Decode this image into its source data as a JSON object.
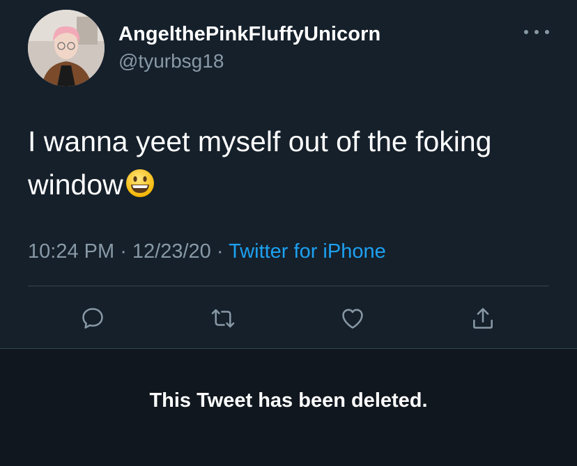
{
  "tweet": {
    "display_name": "AngelthePinkFluffyUnicorn",
    "handle": "@tyurbsg18",
    "text_line1": "I wanna yeet myself out of the foking",
    "text_line2": "window",
    "emoji": "grinning-face-emoji",
    "time": "10:24 PM",
    "separator1": " · ",
    "date": "12/23/20",
    "separator2": " · ",
    "source": "Twitter for iPhone"
  },
  "actions": [
    "reply-icon",
    "retweet-icon",
    "like-icon",
    "share-icon"
  ],
  "notice": {
    "text": "This Tweet has been deleted."
  },
  "colors": {
    "background": "#15202b",
    "notice_background": "#10171e",
    "secondary_text": "#8899a6",
    "link": "#1da1f2",
    "divider": "#38444d"
  }
}
